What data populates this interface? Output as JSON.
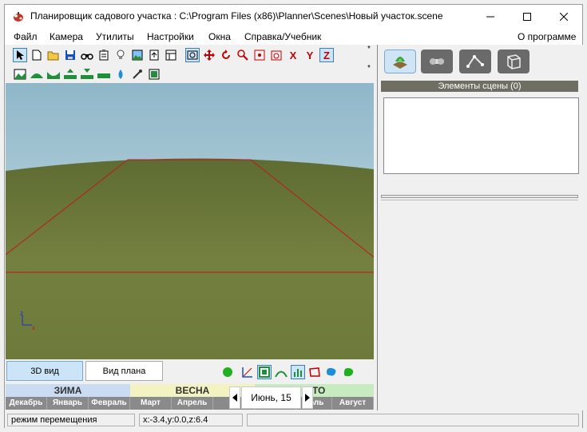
{
  "window": {
    "title": "Планировщик садового участка : C:\\Program Files (x86)\\Planner\\Scenes\\Новый участок.scene",
    "controls": {
      "minimize_icon": "minimize-icon",
      "maximize_icon": "maximize-icon",
      "close_icon": "close-icon"
    }
  },
  "menu": {
    "items": [
      "Файл",
      "Камера",
      "Утилиты",
      "Настройки",
      "Окна",
      "Справка/Учебник"
    ],
    "about": "О программе"
  },
  "toolbar": {
    "axis_labels": [
      "X",
      "Y",
      "Z"
    ],
    "pin_glyph": "*"
  },
  "viewport": {
    "axis_z": "z",
    "axis_x": "x",
    "colors": {
      "sky_top": "#8fb7c9",
      "sky_bottom": "#d4e4e6",
      "ground": "#6e7a3c",
      "plot_outline": "#c01818"
    }
  },
  "right_panel": {
    "scene_header": "Элементы сцены (0)"
  },
  "view_buttons": {
    "view3d": "3D вид",
    "plan": "Вид плана"
  },
  "calendar": {
    "seasons": [
      {
        "name": "ЗИМА",
        "color": "#c9dcf2"
      },
      {
        "name": "ВЕСНА",
        "color": "#f3f3c2"
      },
      {
        "name": "ЕТО",
        "color": "#c7ecbf"
      }
    ],
    "months": [
      "Декабрь",
      "Январь",
      "Февраль",
      "Март",
      "Апрель",
      "",
      "",
      "",
      "оль",
      "Август"
    ],
    "current_date": "Июнь, 15",
    "prev_icon": "triangle-left-icon",
    "next_icon": "triangle-right-icon"
  },
  "status": {
    "mode": "режим перемещения",
    "coords": "x:-3.4,y:0.0,z:6.4"
  }
}
